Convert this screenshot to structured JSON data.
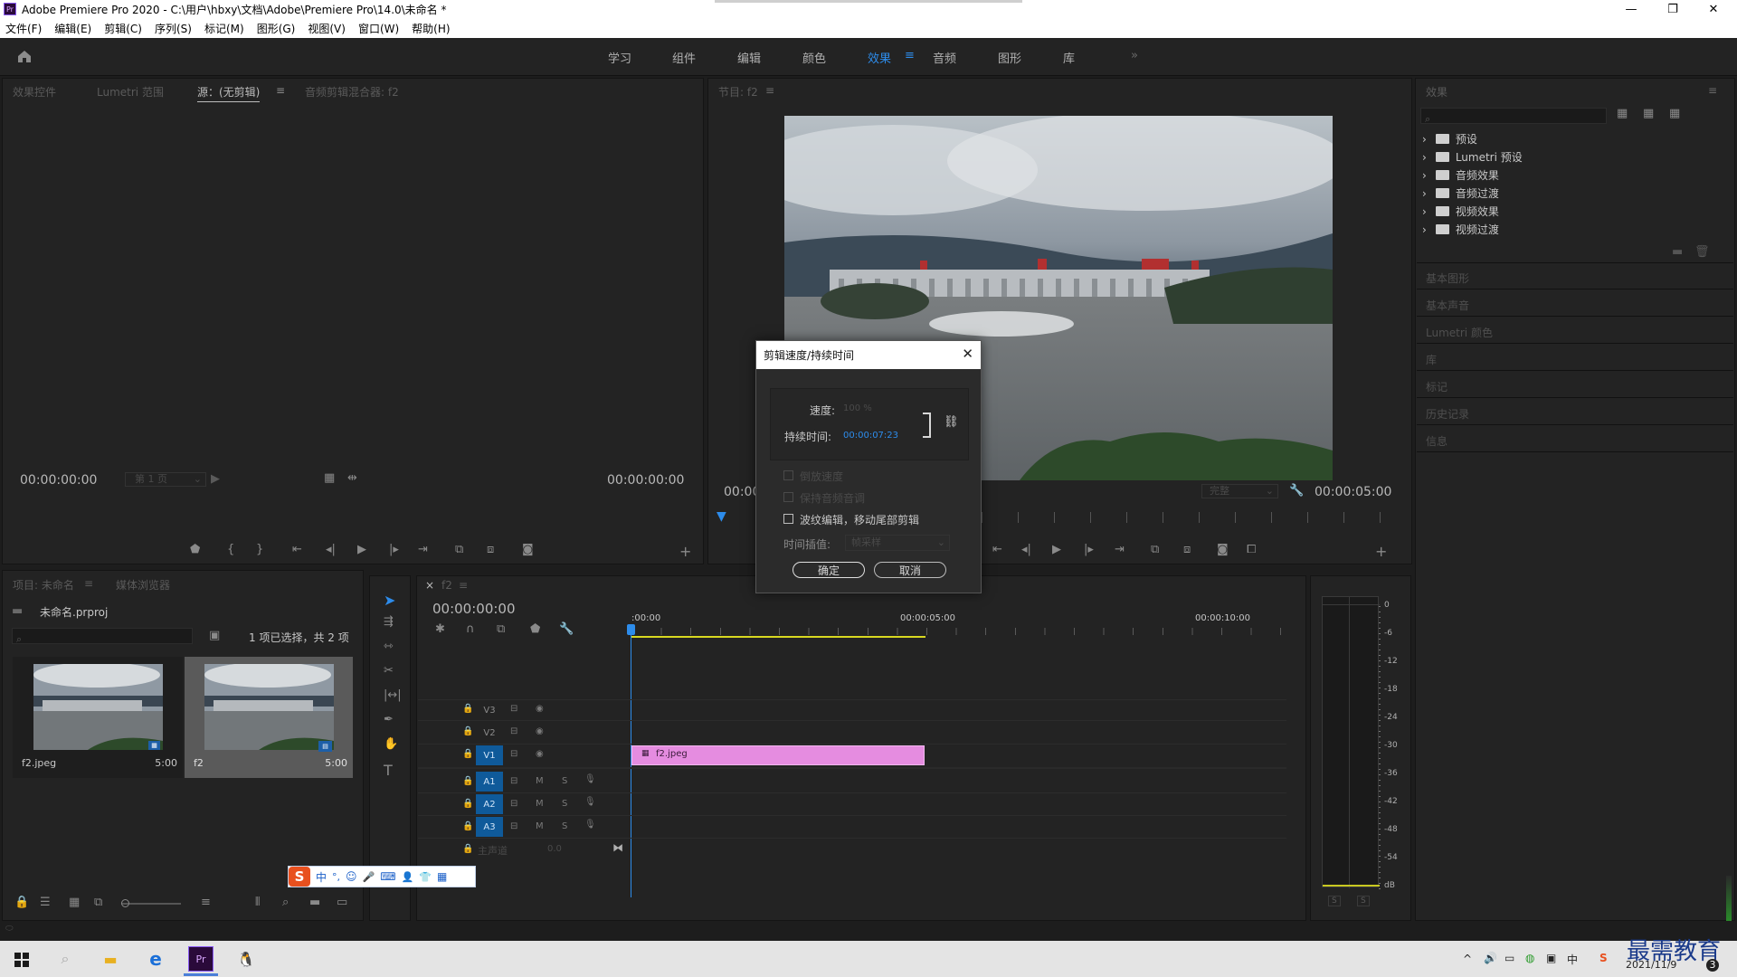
{
  "window": {
    "title": "Adobe Premiere Pro 2020 - C:\\用户\\hbxy\\文档\\Adobe\\Premiere Pro\\14.0\\未命名 *",
    "logo": "Pr",
    "controls": {
      "minimize": "—",
      "maximize": "❐",
      "close": "✕"
    }
  },
  "menu": [
    "文件(F)",
    "编辑(E)",
    "剪辑(C)",
    "序列(S)",
    "标记(M)",
    "图形(G)",
    "视图(V)",
    "窗口(W)",
    "帮助(H)"
  ],
  "workspaces": {
    "tabs": [
      "学习",
      "组件",
      "编辑",
      "颜色",
      "效果",
      "音频",
      "图形",
      "库"
    ],
    "active": "效果",
    "more": "»"
  },
  "source_panel": {
    "tabs": [
      "效果控件",
      "Lumetri 范围",
      "源：(无剪辑)",
      "音频剪辑混合器: f2"
    ],
    "active_tab": "源：(无剪辑)",
    "timecode_left": "00:00:00:00",
    "page": "第 1 页",
    "timecode_right": "00:00:00:00"
  },
  "program_panel": {
    "tab": "节目: f2",
    "timecode_left": "00:00",
    "fit": "完整",
    "timecode_right": "00:00:05:00"
  },
  "dialog": {
    "title": "剪辑速度/持续时间",
    "speed_label": "速度:",
    "speed_value": "100 %",
    "duration_label": "持续时间:",
    "duration_value": "00:00:07:23",
    "options": [
      {
        "label": "倒放速度",
        "checked": false,
        "enabled": false
      },
      {
        "label": "保持音频音调",
        "checked": false,
        "enabled": false
      },
      {
        "label": "波纹编辑，移动尾部剪辑",
        "checked": false,
        "enabled": true
      }
    ],
    "interp_label": "时间插值:",
    "interp_value": "帧采样",
    "ok": "确定",
    "cancel": "取消"
  },
  "effects_panel": {
    "title": "效果",
    "tree": [
      "预设",
      "Lumetri 预设",
      "音频效果",
      "音频过渡",
      "视频效果",
      "视频过渡"
    ],
    "sections": [
      "基本图形",
      "基本声音",
      "Lumetri 颜色",
      "库",
      "标记",
      "历史记录",
      "信息"
    ]
  },
  "project_panel": {
    "tabs": [
      "项目: 未命名",
      "媒体浏览器"
    ],
    "file": "未命名.prproj",
    "selection": "1 项已选择，共 2 项",
    "items": [
      {
        "name": "f2.jpeg",
        "duration": "5:00"
      },
      {
        "name": "f2",
        "duration": "5:00"
      }
    ]
  },
  "timeline": {
    "sequence": "f2",
    "timecode": "00:00:00:00",
    "ruler": [
      ":00:00",
      "00:00:05:00",
      "00:00:10:00"
    ],
    "tracks": [
      "V3",
      "V2",
      "V1",
      "A1",
      "A2",
      "A3"
    ],
    "master": "主声道",
    "master_value": "0.0",
    "clip": "f2.jpeg",
    "clip_color": "#e58ce0"
  },
  "audio_meter": {
    "scale": [
      "0",
      "-6",
      "-12",
      "-18",
      "-24",
      "-30",
      "-36",
      "-42",
      "-48",
      "-54",
      "dB"
    ],
    "buttons": [
      "S",
      "S"
    ]
  },
  "ime_bar": [
    "中",
    "°,",
    "☺",
    "🎤",
    "⌨",
    "👤",
    "👕",
    "▦"
  ],
  "taskbar": {
    "date": "2021/11/9",
    "watermark": "最需教育"
  }
}
